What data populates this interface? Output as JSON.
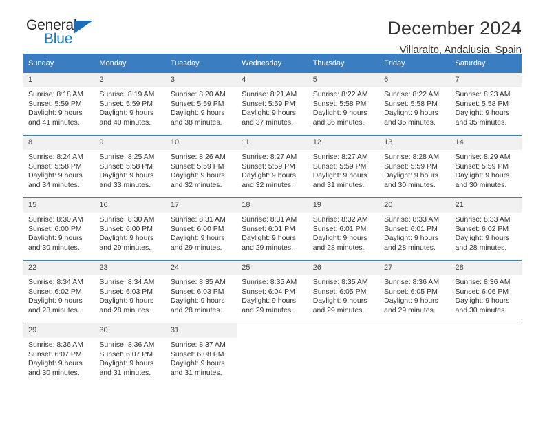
{
  "logo": {
    "word_one": "General",
    "word_two": "Blue",
    "triangle_icon": "blue-triangle-icon",
    "brand_blue": "#1878be",
    "triangle_color": "#1d6cb4"
  },
  "header": {
    "title": "December 2024",
    "subtitle": "Villaralto, Andalusia, Spain"
  },
  "theme": {
    "header_bg": "#3b7dc1",
    "daynum_bg": "#f1f1f1",
    "row_rule": "#3b7dc1",
    "text": "#333333"
  },
  "weekdays": [
    "Sunday",
    "Monday",
    "Tuesday",
    "Wednesday",
    "Thursday",
    "Friday",
    "Saturday"
  ],
  "weeks": [
    [
      {
        "day": "1",
        "sunrise": "Sunrise: 8:18 AM",
        "sunset": "Sunset: 5:59 PM",
        "daylight_1": "Daylight: 9 hours",
        "daylight_2": "and 41 minutes."
      },
      {
        "day": "2",
        "sunrise": "Sunrise: 8:19 AM",
        "sunset": "Sunset: 5:59 PM",
        "daylight_1": "Daylight: 9 hours",
        "daylight_2": "and 40 minutes."
      },
      {
        "day": "3",
        "sunrise": "Sunrise: 8:20 AM",
        "sunset": "Sunset: 5:59 PM",
        "daylight_1": "Daylight: 9 hours",
        "daylight_2": "and 38 minutes."
      },
      {
        "day": "4",
        "sunrise": "Sunrise: 8:21 AM",
        "sunset": "Sunset: 5:59 PM",
        "daylight_1": "Daylight: 9 hours",
        "daylight_2": "and 37 minutes."
      },
      {
        "day": "5",
        "sunrise": "Sunrise: 8:22 AM",
        "sunset": "Sunset: 5:58 PM",
        "daylight_1": "Daylight: 9 hours",
        "daylight_2": "and 36 minutes."
      },
      {
        "day": "6",
        "sunrise": "Sunrise: 8:22 AM",
        "sunset": "Sunset: 5:58 PM",
        "daylight_1": "Daylight: 9 hours",
        "daylight_2": "and 35 minutes."
      },
      {
        "day": "7",
        "sunrise": "Sunrise: 8:23 AM",
        "sunset": "Sunset: 5:58 PM",
        "daylight_1": "Daylight: 9 hours",
        "daylight_2": "and 35 minutes."
      }
    ],
    [
      {
        "day": "8",
        "sunrise": "Sunrise: 8:24 AM",
        "sunset": "Sunset: 5:58 PM",
        "daylight_1": "Daylight: 9 hours",
        "daylight_2": "and 34 minutes."
      },
      {
        "day": "9",
        "sunrise": "Sunrise: 8:25 AM",
        "sunset": "Sunset: 5:58 PM",
        "daylight_1": "Daylight: 9 hours",
        "daylight_2": "and 33 minutes."
      },
      {
        "day": "10",
        "sunrise": "Sunrise: 8:26 AM",
        "sunset": "Sunset: 5:59 PM",
        "daylight_1": "Daylight: 9 hours",
        "daylight_2": "and 32 minutes."
      },
      {
        "day": "11",
        "sunrise": "Sunrise: 8:27 AM",
        "sunset": "Sunset: 5:59 PM",
        "daylight_1": "Daylight: 9 hours",
        "daylight_2": "and 32 minutes."
      },
      {
        "day": "12",
        "sunrise": "Sunrise: 8:27 AM",
        "sunset": "Sunset: 5:59 PM",
        "daylight_1": "Daylight: 9 hours",
        "daylight_2": "and 31 minutes."
      },
      {
        "day": "13",
        "sunrise": "Sunrise: 8:28 AM",
        "sunset": "Sunset: 5:59 PM",
        "daylight_1": "Daylight: 9 hours",
        "daylight_2": "and 30 minutes."
      },
      {
        "day": "14",
        "sunrise": "Sunrise: 8:29 AM",
        "sunset": "Sunset: 5:59 PM",
        "daylight_1": "Daylight: 9 hours",
        "daylight_2": "and 30 minutes."
      }
    ],
    [
      {
        "day": "15",
        "sunrise": "Sunrise: 8:30 AM",
        "sunset": "Sunset: 6:00 PM",
        "daylight_1": "Daylight: 9 hours",
        "daylight_2": "and 30 minutes."
      },
      {
        "day": "16",
        "sunrise": "Sunrise: 8:30 AM",
        "sunset": "Sunset: 6:00 PM",
        "daylight_1": "Daylight: 9 hours",
        "daylight_2": "and 29 minutes."
      },
      {
        "day": "17",
        "sunrise": "Sunrise: 8:31 AM",
        "sunset": "Sunset: 6:00 PM",
        "daylight_1": "Daylight: 9 hours",
        "daylight_2": "and 29 minutes."
      },
      {
        "day": "18",
        "sunrise": "Sunrise: 8:31 AM",
        "sunset": "Sunset: 6:01 PM",
        "daylight_1": "Daylight: 9 hours",
        "daylight_2": "and 29 minutes."
      },
      {
        "day": "19",
        "sunrise": "Sunrise: 8:32 AM",
        "sunset": "Sunset: 6:01 PM",
        "daylight_1": "Daylight: 9 hours",
        "daylight_2": "and 28 minutes."
      },
      {
        "day": "20",
        "sunrise": "Sunrise: 8:33 AM",
        "sunset": "Sunset: 6:01 PM",
        "daylight_1": "Daylight: 9 hours",
        "daylight_2": "and 28 minutes."
      },
      {
        "day": "21",
        "sunrise": "Sunrise: 8:33 AM",
        "sunset": "Sunset: 6:02 PM",
        "daylight_1": "Daylight: 9 hours",
        "daylight_2": "and 28 minutes."
      }
    ],
    [
      {
        "day": "22",
        "sunrise": "Sunrise: 8:34 AM",
        "sunset": "Sunset: 6:02 PM",
        "daylight_1": "Daylight: 9 hours",
        "daylight_2": "and 28 minutes."
      },
      {
        "day": "23",
        "sunrise": "Sunrise: 8:34 AM",
        "sunset": "Sunset: 6:03 PM",
        "daylight_1": "Daylight: 9 hours",
        "daylight_2": "and 28 minutes."
      },
      {
        "day": "24",
        "sunrise": "Sunrise: 8:35 AM",
        "sunset": "Sunset: 6:03 PM",
        "daylight_1": "Daylight: 9 hours",
        "daylight_2": "and 28 minutes."
      },
      {
        "day": "25",
        "sunrise": "Sunrise: 8:35 AM",
        "sunset": "Sunset: 6:04 PM",
        "daylight_1": "Daylight: 9 hours",
        "daylight_2": "and 29 minutes."
      },
      {
        "day": "26",
        "sunrise": "Sunrise: 8:35 AM",
        "sunset": "Sunset: 6:05 PM",
        "daylight_1": "Daylight: 9 hours",
        "daylight_2": "and 29 minutes."
      },
      {
        "day": "27",
        "sunrise": "Sunrise: 8:36 AM",
        "sunset": "Sunset: 6:05 PM",
        "daylight_1": "Daylight: 9 hours",
        "daylight_2": "and 29 minutes."
      },
      {
        "day": "28",
        "sunrise": "Sunrise: 8:36 AM",
        "sunset": "Sunset: 6:06 PM",
        "daylight_1": "Daylight: 9 hours",
        "daylight_2": "and 30 minutes."
      }
    ],
    [
      {
        "day": "29",
        "sunrise": "Sunrise: 8:36 AM",
        "sunset": "Sunset: 6:07 PM",
        "daylight_1": "Daylight: 9 hours",
        "daylight_2": "and 30 minutes."
      },
      {
        "day": "30",
        "sunrise": "Sunrise: 8:36 AM",
        "sunset": "Sunset: 6:07 PM",
        "daylight_1": "Daylight: 9 hours",
        "daylight_2": "and 31 minutes."
      },
      {
        "day": "31",
        "sunrise": "Sunrise: 8:37 AM",
        "sunset": "Sunset: 6:08 PM",
        "daylight_1": "Daylight: 9 hours",
        "daylight_2": "and 31 minutes."
      },
      {
        "day": "",
        "sunrise": "",
        "sunset": "",
        "daylight_1": "",
        "daylight_2": ""
      },
      {
        "day": "",
        "sunrise": "",
        "sunset": "",
        "daylight_1": "",
        "daylight_2": ""
      },
      {
        "day": "",
        "sunrise": "",
        "sunset": "",
        "daylight_1": "",
        "daylight_2": ""
      },
      {
        "day": "",
        "sunrise": "",
        "sunset": "",
        "daylight_1": "",
        "daylight_2": ""
      }
    ]
  ]
}
